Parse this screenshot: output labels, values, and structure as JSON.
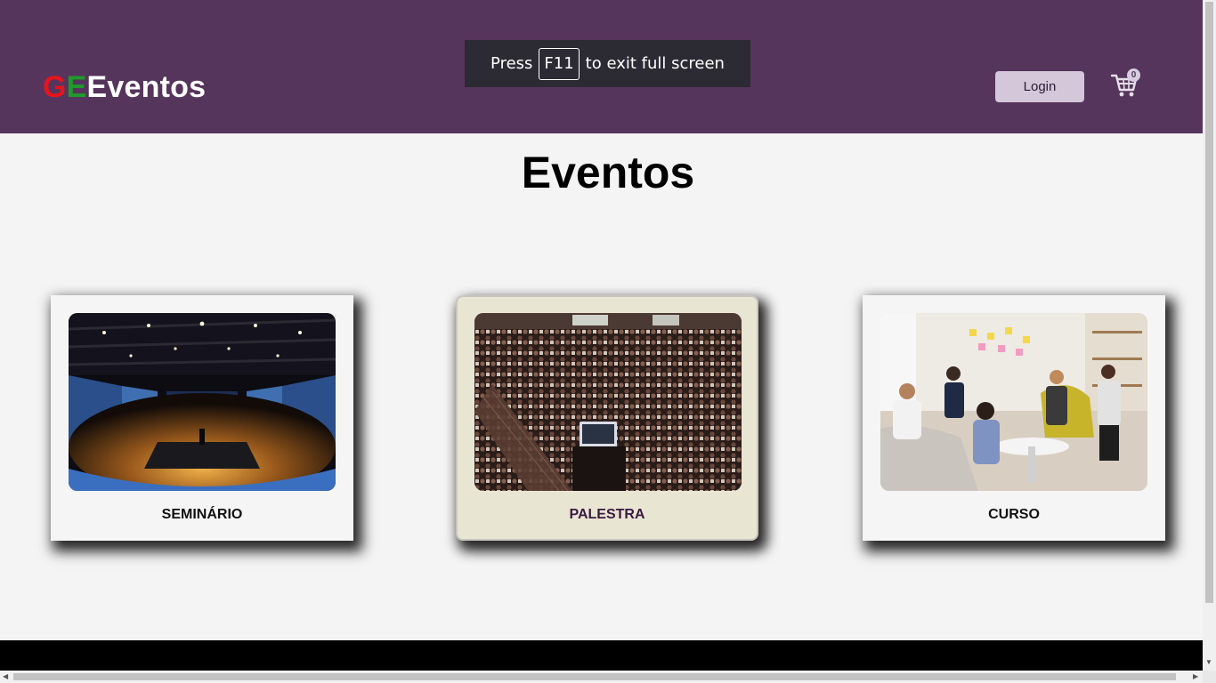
{
  "header": {
    "logo": {
      "part1": "G",
      "part2": "E",
      "part3": "Eventos"
    },
    "login_label": "Login",
    "cart_count": "0"
  },
  "fullscreen_notice": {
    "before": "Press",
    "key": "F11",
    "after": "to exit full screen"
  },
  "main": {
    "title": "Eventos",
    "cards": [
      {
        "label": "SEMINÁRIO",
        "image": "seminar-auditorium-photo"
      },
      {
        "label": "PALESTRA",
        "image": "lecture-audience-photo"
      },
      {
        "label": "CURSO",
        "image": "course-meeting-photo"
      }
    ]
  },
  "colors": {
    "header_bg": "#56355d",
    "logo_g": "#e8141b",
    "logo_e": "#1f9a2b",
    "card_hover_bg": "#e9e5d3",
    "footer_bg": "#000000"
  }
}
